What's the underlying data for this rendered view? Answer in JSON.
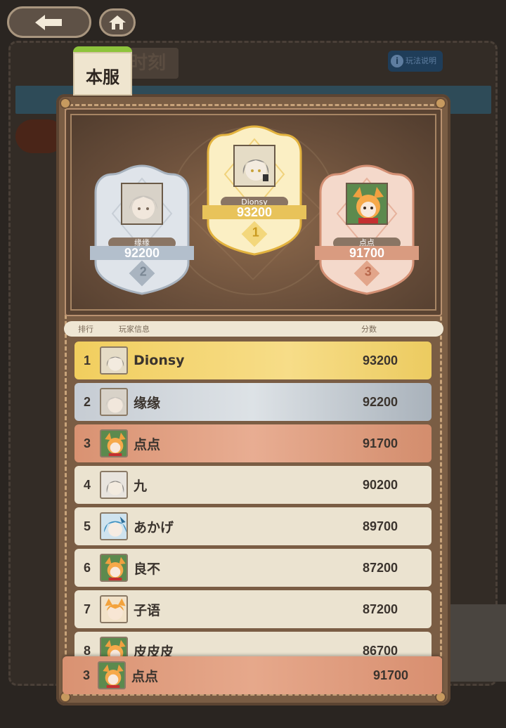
{
  "background": {
    "title_fragment": "时刻",
    "help_label": "玩法说明"
  },
  "nav": {
    "back_icon": "back-arrow-icon",
    "home_icon": "home-icon"
  },
  "tab": {
    "label": "本服"
  },
  "podium": [
    {
      "rank": "2",
      "name": "缘缘",
      "score": "92200",
      "avatar": "silver-hair-girl",
      "tier": "silver"
    },
    {
      "rank": "1",
      "name": "Dionsy",
      "score": "93200",
      "avatar": "gray-hair-girl",
      "tier": "gold"
    },
    {
      "rank": "3",
      "name": "点点",
      "score": "91700",
      "avatar": "fox-girl",
      "tier": "bronze"
    }
  ],
  "list_header": {
    "rank": "排行",
    "player": "玩家信息",
    "score": "分数"
  },
  "rows": [
    {
      "rank": "1",
      "name": "Dionsy",
      "score": "93200",
      "avatar": "gray-hair-girl",
      "tier": "gold"
    },
    {
      "rank": "2",
      "name": "缘缘",
      "score": "92200",
      "avatar": "silver-hair-girl",
      "tier": "silver"
    },
    {
      "rank": "3",
      "name": "点点",
      "score": "91700",
      "avatar": "fox-girl",
      "tier": "bronze"
    },
    {
      "rank": "4",
      "name": "九",
      "score": "90200",
      "avatar": "gray-hair-girl",
      "tier": "plain"
    },
    {
      "rank": "5",
      "name": "あかげ",
      "score": "89700",
      "avatar": "blue-hair-girl",
      "tier": "plain"
    },
    {
      "rank": "6",
      "name": "良不",
      "score": "87200",
      "avatar": "fox-girl",
      "tier": "plain"
    },
    {
      "rank": "7",
      "name": "子语",
      "score": "87200",
      "avatar": "orange-cat-girl",
      "tier": "plain"
    },
    {
      "rank": "8",
      "name": "皮皮皮",
      "score": "86700",
      "avatar": "fox-girl",
      "tier": "plain"
    }
  ],
  "self_row": {
    "rank": "3",
    "name": "点点",
    "score": "91700",
    "avatar": "fox-girl"
  },
  "colors": {
    "gold": "#f1ce5e",
    "silver": "#c6ccd3",
    "bronze": "#d99272",
    "plain": "#ebe3d0",
    "tab_accent": "#8ec43c"
  }
}
